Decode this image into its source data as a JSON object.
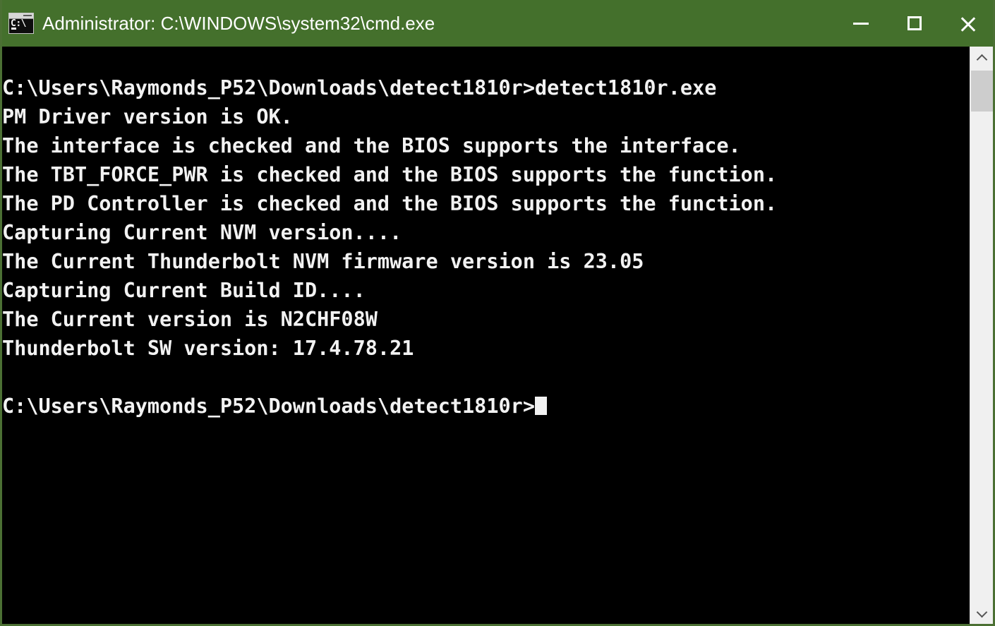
{
  "window": {
    "title": "Administrator: C:\\WINDOWS\\system32\\cmd.exe",
    "icon_name": "cmd-icon",
    "icon_text": "C:\\",
    "titlebar_color": "#44702c",
    "background_color": "#000000",
    "foreground_color": "#f2f2f2",
    "border_color": "#4b7033"
  },
  "controls": {
    "minimize_label": "Minimize",
    "maximize_label": "Maximize",
    "close_label": "Close"
  },
  "console": {
    "lines": [
      "C:\\Users\\Raymonds_P52\\Downloads\\detect1810r>detect1810r.exe",
      "PM Driver version is OK.",
      "The interface is checked and the BIOS supports the interface.",
      "The TBT_FORCE_PWR is checked and the BIOS supports the function.",
      "The PD Controller is checked and the BIOS supports the function.",
      "Capturing Current NVM version....",
      "The Current Thunderbolt NVM firmware version is 23.05",
      "Capturing Current Build ID....",
      "The Current version is N2CHF08W",
      "Thunderbolt SW version: 17.4.78.21",
      "",
      "C:\\Users\\Raymonds_P52\\Downloads\\detect1810r>"
    ],
    "prompt_line_index": 11,
    "cursor": "block"
  },
  "scrollbar": {
    "up_arrow": "chevron-up-icon",
    "down_arrow": "chevron-down-icon",
    "thumb_color": "#cdcdcd",
    "track_color": "#f0f0f0"
  }
}
